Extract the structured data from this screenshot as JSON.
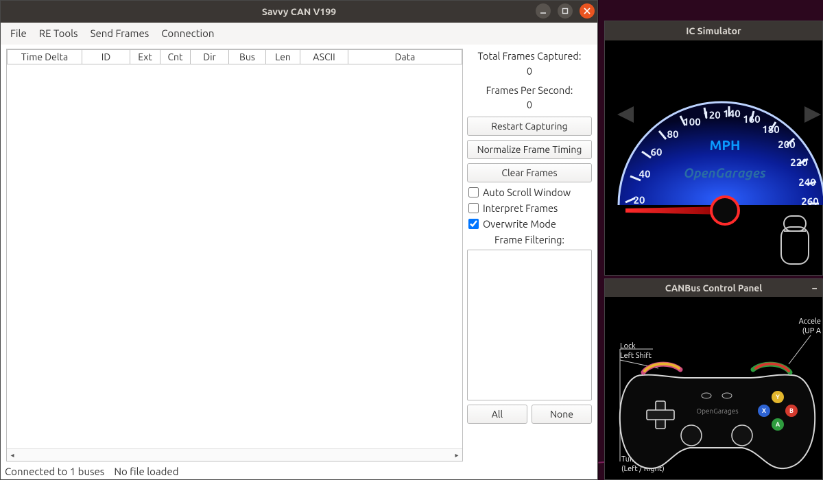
{
  "savvy": {
    "title": "Savvy CAN V199",
    "menu": {
      "file": "File",
      "re": "RE Tools",
      "send": "Send Frames",
      "conn": "Connection"
    },
    "cols": {
      "time": "Time Delta",
      "id": "ID",
      "ext": "Ext",
      "cnt": "Cnt",
      "dir": "Dir",
      "bus": "Bus",
      "len": "Len",
      "ascii": "ASCII",
      "data": "Data"
    },
    "stats": {
      "total_label": "Total Frames Captured:",
      "total_value": "0",
      "fps_label": "Frames Per Second:",
      "fps_value": "0"
    },
    "buttons": {
      "restart": "Restart Capturing",
      "normalize": "Normalize Frame Timing",
      "clear": "Clear Frames",
      "all": "All",
      "none": "None"
    },
    "checks": {
      "autoscroll": "Auto Scroll Window",
      "interpret": "Interpret Frames",
      "overwrite": "Overwrite Mode"
    },
    "filter_label": "Frame Filtering:",
    "status": {
      "conn": "Connected to 1 buses",
      "file": "No file loaded"
    }
  },
  "ic": {
    "title": "IC Simulator",
    "unit": "MPH",
    "brand": "OpenGarages",
    "ticks": [
      "20",
      "40",
      "60",
      "80",
      "100",
      "120",
      "140",
      "160",
      "180",
      "200",
      "220",
      "240",
      "260"
    ]
  },
  "cb": {
    "title": "CANBus Control Panel",
    "brand": "OpenGarages",
    "labels": {
      "lock": "Lock",
      "leftshift": "Left Shift",
      "accel": "Accele",
      "accel_sub": "(UP A",
      "turn": "Turn",
      "turn_sub": "(Left / Right)"
    },
    "face_buttons": {
      "y": "Y",
      "b": "B",
      "a": "A",
      "x": "X"
    }
  }
}
